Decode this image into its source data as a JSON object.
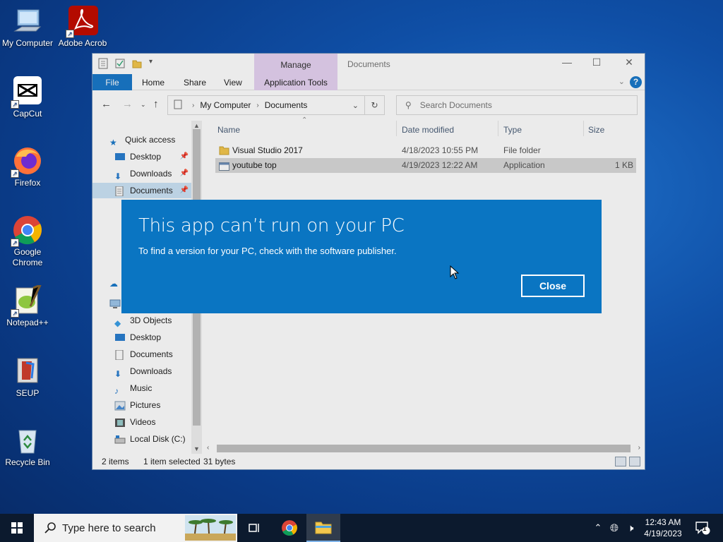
{
  "desktop": {
    "icons": [
      {
        "label": "My Computer",
        "icon": "computer-icon"
      },
      {
        "label": "Adobe Acrob",
        "icon": "acrobat-icon"
      },
      {
        "label": "CapCut",
        "icon": "capcut-icon"
      },
      {
        "label": "Firefox",
        "icon": "firefox-icon"
      },
      {
        "label": "Google Chrome",
        "icon": "chrome-icon"
      },
      {
        "label": "Notepad++",
        "icon": "notepadpp-icon"
      },
      {
        "label": "SEUP",
        "icon": "seup-icon"
      },
      {
        "label": "Recycle Bin",
        "icon": "recycle-bin-icon"
      }
    ]
  },
  "explorer": {
    "title": "Documents",
    "manage_tab": "Manage",
    "ribbon_tabs": [
      "File",
      "Home",
      "Share",
      "View",
      "Application Tools"
    ],
    "address": {
      "root": "My Computer",
      "current": "Documents"
    },
    "search_placeholder": "Search Documents",
    "nav": {
      "quick_access": "Quick access",
      "quick_items": [
        {
          "label": "Desktop",
          "pinned": true
        },
        {
          "label": "Downloads",
          "pinned": true
        },
        {
          "label": "Documents",
          "pinned": true,
          "selected": true
        }
      ],
      "pc_items": [
        "3D Objects",
        "Desktop",
        "Documents",
        "Downloads",
        "Music",
        "Pictures",
        "Videos",
        "Local Disk (C:)"
      ]
    },
    "columns": [
      "Name",
      "Date modified",
      "Type",
      "Size"
    ],
    "files": [
      {
        "name": "Visual Studio 2017",
        "date": "4/18/2023 10:55 PM",
        "type": "File folder",
        "size": "",
        "icon": "folder-icon"
      },
      {
        "name": "youtube top",
        "date": "4/19/2023 12:22 AM",
        "type": "Application",
        "size": "1 KB",
        "icon": "application-icon",
        "selected": true
      }
    ],
    "status": {
      "count": "2 items",
      "selected": "1 item selected",
      "size": "31 bytes"
    }
  },
  "dialog": {
    "title": "This app can’t run on your PC",
    "message": "To find a version for your PC, check with the software publisher.",
    "close_label": "Close",
    "bg_color": "#0a75c2"
  },
  "taskbar": {
    "search_placeholder": "Type here to search",
    "time": "12:43 AM",
    "date": "4/19/2023",
    "notification_count": "1"
  }
}
